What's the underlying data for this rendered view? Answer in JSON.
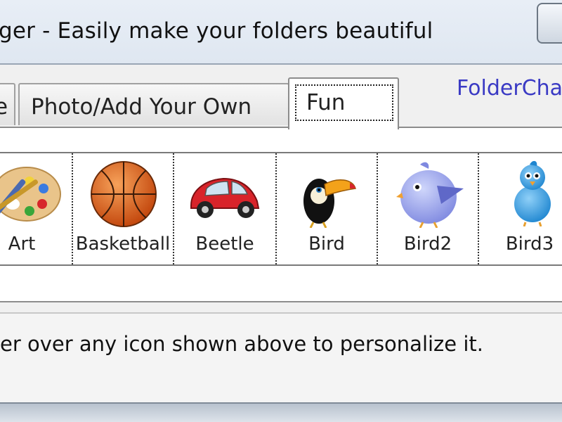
{
  "window": {
    "title": "ger - Easily make your folders beautiful"
  },
  "tabs": [
    {
      "label": "e",
      "selected": false
    },
    {
      "label": "Photo/Add Your Own",
      "selected": false
    },
    {
      "label": "Fun",
      "selected": true
    }
  ],
  "brand_link": "FolderCha",
  "icons": [
    {
      "label": "Art",
      "icon": "paint-palette-icon"
    },
    {
      "label": "Basketball",
      "icon": "basketball-icon"
    },
    {
      "label": "Beetle",
      "icon": "red-beetle-car-icon"
    },
    {
      "label": "Bird",
      "icon": "toucan-icon"
    },
    {
      "label": "Bird2",
      "icon": "blue-chubby-bird-icon"
    },
    {
      "label": "Bird3",
      "icon": "blue-twitter-bird-icon"
    }
  ],
  "hint": "er over any icon shown above to personalize it.",
  "colors": {
    "link": "#3a3ac4",
    "selected_tab_bg": "#ffffff"
  }
}
